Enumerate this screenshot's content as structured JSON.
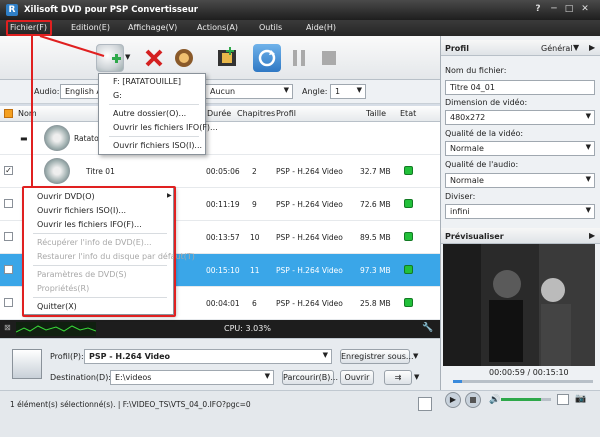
{
  "app": {
    "title": "Xilisoft DVD pour PSP Convertisseur"
  },
  "menu": [
    "Fichier(F)",
    "Edition(E)",
    "Affichage(V)",
    "Actions(A)",
    "Outils",
    "Aide(H)"
  ],
  "options": {
    "audio_label": "Audio:",
    "audio_value": "English A",
    "subtitle_value": "Aucun",
    "angle_label": "Angle:",
    "angle_value": "1"
  },
  "columns": {
    "nom": "Nom",
    "duree": "Durée",
    "chapitres": "Chapitres",
    "profil": "Profil",
    "taille": "Taille",
    "etat": "Etat"
  },
  "rows": [
    {
      "name": "Ratatou",
      "duree": "",
      "chapitres": "",
      "profil": "",
      "taille": ""
    },
    {
      "name": "Titre 01",
      "duree": "00:05:06",
      "chapitres": "2",
      "profil": "PSP - H.264 Video",
      "taille": "32.7 MB"
    },
    {
      "name": "",
      "duree": "00:11:19",
      "chapitres": "9",
      "profil": "PSP - H.264 Video",
      "taille": "72.6 MB"
    },
    {
      "name": "",
      "duree": "00:13:57",
      "chapitres": "10",
      "profil": "PSP - H.264 Video",
      "taille": "89.5 MB"
    },
    {
      "name": "",
      "duree": "00:15:10",
      "chapitres": "11",
      "profil": "PSP - H.264 Video",
      "taille": "97.3 MB"
    },
    {
      "name": "",
      "duree": "00:04:01",
      "chapitres": "6",
      "profil": "PSP - H.264 Video",
      "taille": "25.8 MB"
    }
  ],
  "toolbar_dropdown": [
    "F: [RATATOUILLE]",
    "G:",
    "Autre dossier(O)...",
    "Ouvrir les fichiers IFO(F)...",
    "Ouvrir fichiers ISO(I)..."
  ],
  "file_menu": [
    {
      "label": "Ouvrir DVD(O)",
      "disabled": false
    },
    {
      "label": "Ouvrir fichiers ISO(I)...",
      "disabled": false
    },
    {
      "label": "Ouvrir les fichiers IFO(F)...",
      "disabled": false
    },
    {
      "label": "Récupérer l'info de DVD(E)...",
      "disabled": true
    },
    {
      "label": "Restaurer l'info du disque par défaut(T)",
      "disabled": true
    },
    {
      "label": "Paramètres de DVD(S)",
      "disabled": true
    },
    {
      "label": "Propriétés(R)",
      "disabled": true
    },
    {
      "label": "Quitter(X)",
      "disabled": false
    }
  ],
  "cpu": "CPU: 3.03%",
  "bottom": {
    "profil_label": "Profil(P):",
    "profil_value": "PSP - H.264 Video",
    "save_as": "Enregistrer sous...",
    "dest_label": "Destination(D):",
    "dest_value": "E:\\videos",
    "browse": "Parcourir(B)...",
    "open": "Ouvrir"
  },
  "status": "1 élément(s) sélectionné(s). | F:\\VIDEO_TS\\VTS_04_0.IFO?pgc=0",
  "profile_panel": {
    "title": "Profil",
    "mode": "Général",
    "filename_label": "Nom du fichier:",
    "filename_value": "Titre 04_01",
    "dim_label": "Dimension de vidéo:",
    "dim_value": "480x272",
    "vq_label": "Qualité de la vidéo:",
    "vq_value": "Normale",
    "aq_label": "Qualité de l'audio:",
    "aq_value": "Normale",
    "split_label": "Diviser:",
    "split_value": "infini"
  },
  "preview": {
    "title": "Prévisualiser",
    "time": "00:00:59 / 00:15:10",
    "progress": 0.065
  }
}
